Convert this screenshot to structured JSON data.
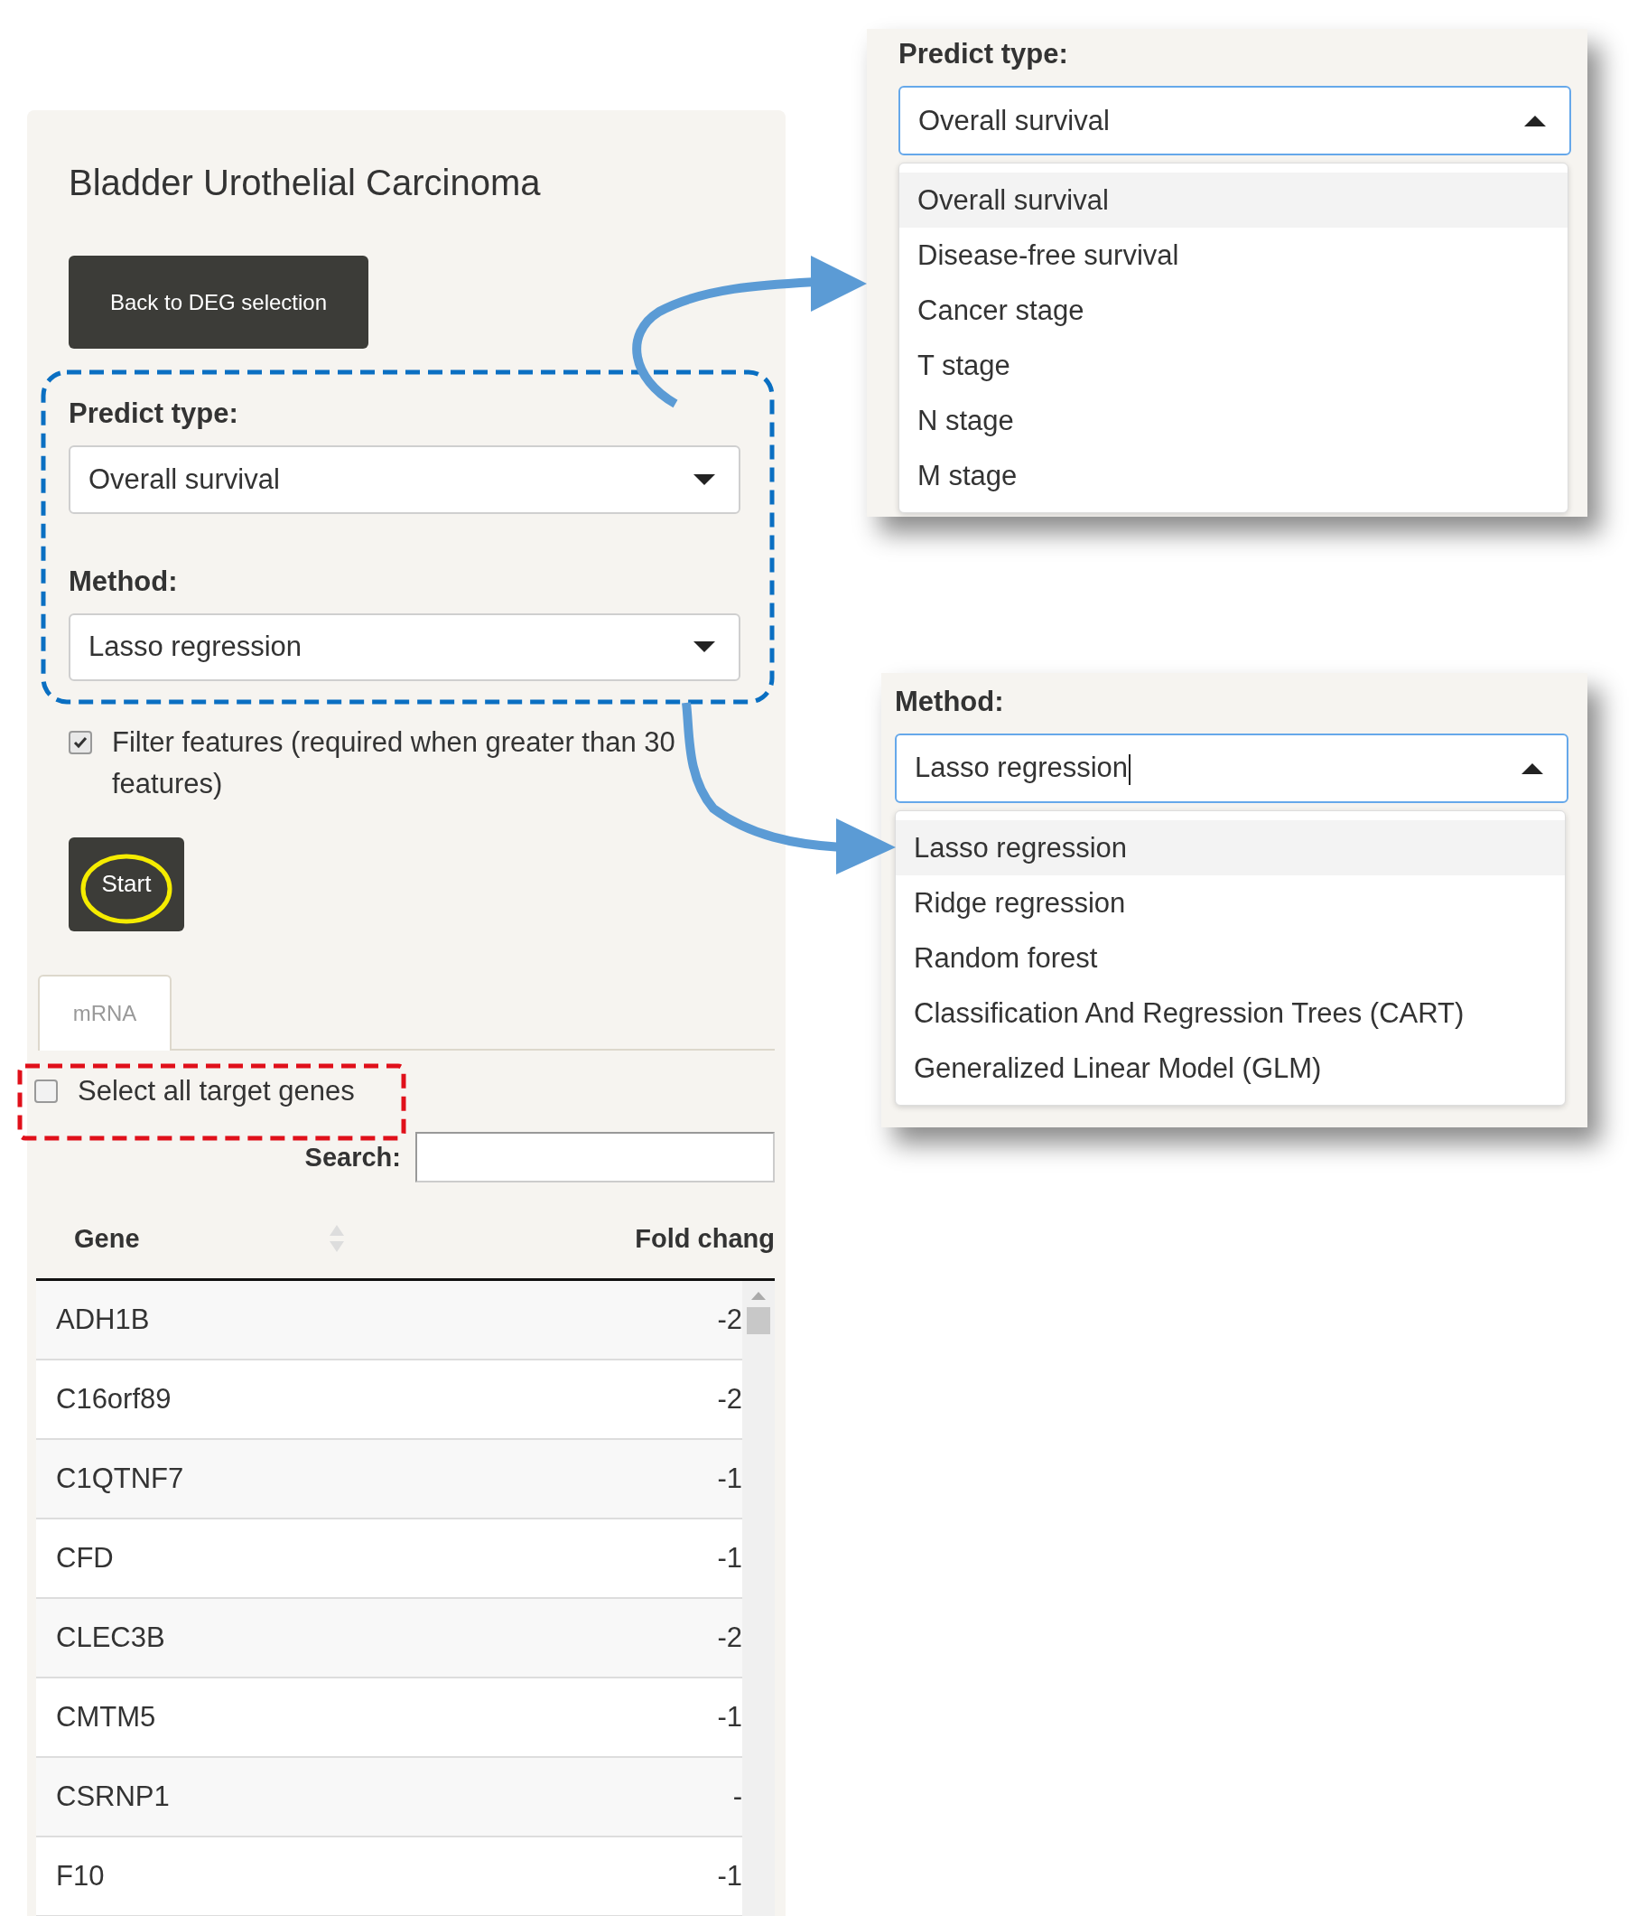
{
  "main_panel": {
    "title": "Bladder Urothelial Carcinoma",
    "back_button": "Back to DEG selection",
    "fields": [
      {
        "label": "Predict type:",
        "value": "Overall survival"
      },
      {
        "label": "Method:",
        "value": "Lasso regression"
      }
    ],
    "filter_checkbox": {
      "label": "Filter features (required when greater than 30 features)",
      "checked": true
    },
    "start_button": "Start",
    "tabs": [
      {
        "label": "mRNA",
        "selected": true
      }
    ],
    "select_all": {
      "label": "Select all target genes",
      "checked": false
    },
    "search": {
      "label": "Search:"
    },
    "table": {
      "columns": [
        "Gene",
        "Fold chang"
      ],
      "rows": [
        {
          "gene": "ADH1B",
          "fold_change": "-2"
        },
        {
          "gene": "C16orf89",
          "fold_change": "-2"
        },
        {
          "gene": "C1QTNF7",
          "fold_change": "-1"
        },
        {
          "gene": "CFD",
          "fold_change": "-1"
        },
        {
          "gene": "CLEC3B",
          "fold_change": "-2"
        },
        {
          "gene": "CMTM5",
          "fold_change": "-1"
        },
        {
          "gene": "CSRNP1",
          "fold_change": "-"
        },
        {
          "gene": "F10",
          "fold_change": "-1"
        }
      ]
    }
  },
  "dropdowns": [
    {
      "label": "Predict type:",
      "value": "Overall survival",
      "cursor": false,
      "options": [
        {
          "label": "Overall survival",
          "selected": true
        },
        {
          "label": "Disease-free survival",
          "selected": false
        },
        {
          "label": "Cancer stage",
          "selected": false
        },
        {
          "label": "T stage",
          "selected": false
        },
        {
          "label": "N stage",
          "selected": false
        },
        {
          "label": "M stage",
          "selected": false
        }
      ]
    },
    {
      "label": "Method:",
      "value": "Lasso regression",
      "cursor": true,
      "options": [
        {
          "label": "Lasso regression",
          "selected": true
        },
        {
          "label": "Ridge regression",
          "selected": false
        },
        {
          "label": "Random forest",
          "selected": false
        },
        {
          "label": "Classification And Regression Trees (CART)",
          "selected": false
        },
        {
          "label": "Generalized Linear Model (GLM)",
          "selected": false
        }
      ]
    }
  ]
}
